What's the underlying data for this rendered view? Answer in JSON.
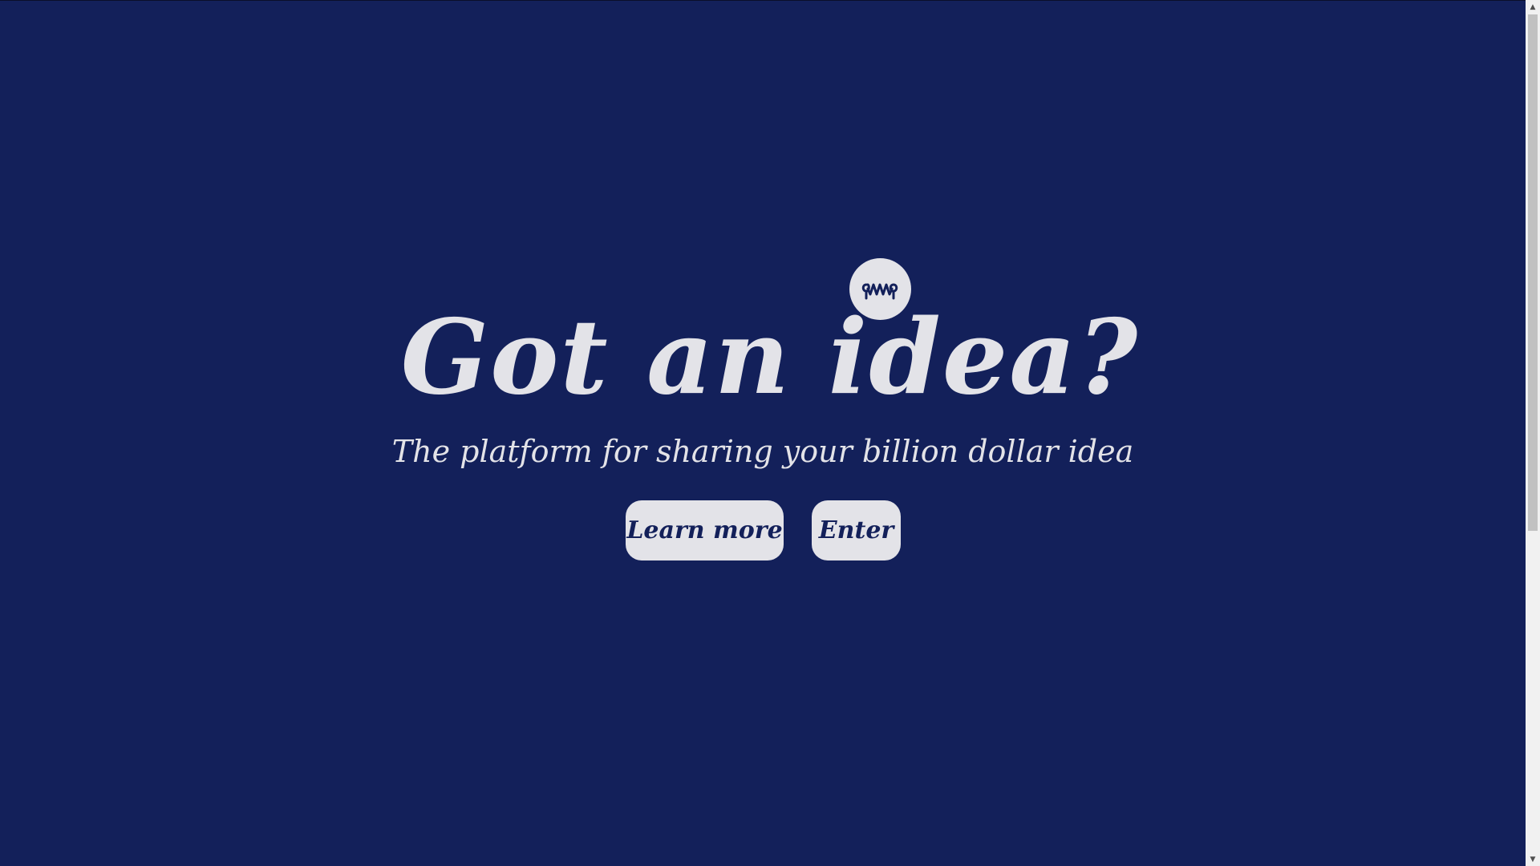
{
  "hero": {
    "logo_icon": "brain-squiggle-icon",
    "headline": "Got an idea?",
    "subtitle": "The platform for sharing your billion dollar idea"
  },
  "actions": {
    "learn_more_label": "Learn more",
    "enter_label": "Enter"
  },
  "scrollbar": {
    "up_arrow": "▲",
    "down_arrow": "▼"
  },
  "colors": {
    "background": "#13205a",
    "foreground": "#e3e3e8"
  }
}
